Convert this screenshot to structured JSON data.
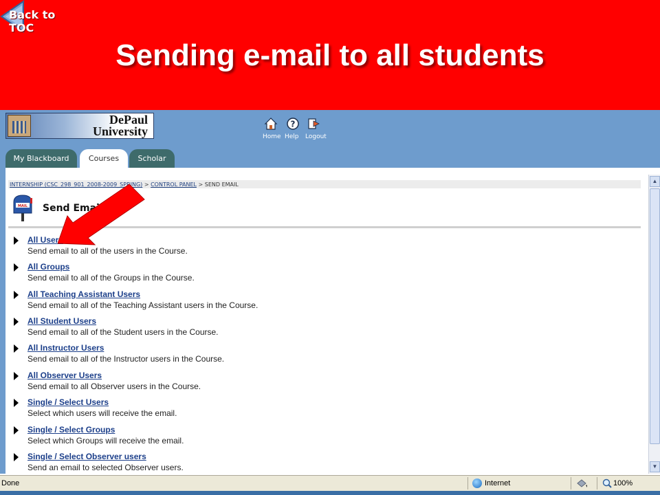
{
  "slide": {
    "back_label": "Back to TOC",
    "title": "Sending e-mail to all students"
  },
  "logo": {
    "line1": "DePaul",
    "line2": "University"
  },
  "top_nav": [
    {
      "label": "Home",
      "icon": "home-icon"
    },
    {
      "label": "Help",
      "icon": "help-icon"
    },
    {
      "label": "Logout",
      "icon": "logout-icon"
    }
  ],
  "tabs": [
    {
      "label": "My Blackboard",
      "active": false
    },
    {
      "label": "Courses",
      "active": true
    },
    {
      "label": "Scholar",
      "active": false
    }
  ],
  "breadcrumb": {
    "course": "INTERNSHIP (CSC_298_901_2008-2009_SPRING)",
    "control_panel": "CONTROL PANEL",
    "current": "SEND EMAIL",
    "separator": ">"
  },
  "page": {
    "title": "Send Email"
  },
  "items": [
    {
      "link": "All Users",
      "desc": "Send email to all of the users in the Course."
    },
    {
      "link": "All Groups",
      "desc": "Send email to all of the Groups in the Course."
    },
    {
      "link": "All Teaching Assistant Users",
      "desc": "Send email to all of the Teaching Assistant users in the Course."
    },
    {
      "link": "All Student Users",
      "desc": "Send email to all of the Student users in the Course."
    },
    {
      "link": "All Instructor Users",
      "desc": "Send email to all of the Instructor users in the Course."
    },
    {
      "link": "All Observer Users",
      "desc": "Send email to all Observer users in the Course."
    },
    {
      "link": "Single / Select Users",
      "desc": "Select which users will receive the email."
    },
    {
      "link": "Single / Select Groups",
      "desc": "Select which Groups will receive the email."
    },
    {
      "link": "Single / Select Observer users",
      "desc": "Send an email to selected Observer users."
    }
  ],
  "status": {
    "text": "Done",
    "zone": "Internet",
    "zoom": "100%"
  },
  "colors": {
    "slide_bg": "#ff0000",
    "frame_blue": "#6e9ccd",
    "tab_green": "#3e6b6b",
    "link_blue": "#1c3f8a",
    "arrow_red": "#ff0000"
  }
}
